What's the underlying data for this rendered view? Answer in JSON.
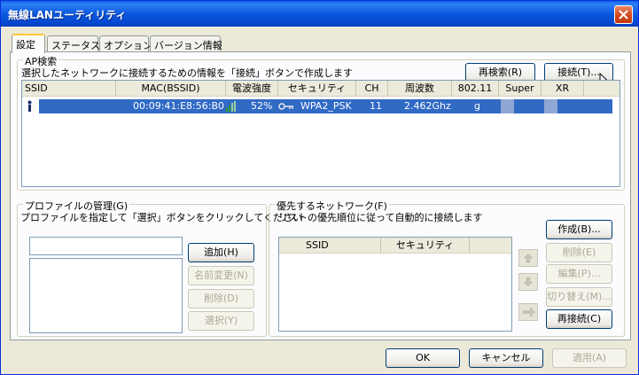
{
  "window": {
    "title": "無線LANユーティリティ"
  },
  "tabs": [
    "設定",
    "ステータス",
    "オプション",
    "バージョン情報"
  ],
  "ap_search": {
    "title": "AP検索",
    "description": "選択したネットワークに接続するための情報を「接続」ボタンで作成します",
    "rescan_label": "再検索(R)",
    "connect_label": "接続(T)...",
    "columns": [
      "SSID",
      "MAC(BSSID)",
      "電波強度",
      "セキュリティ",
      "CH",
      "周波数",
      "802.11",
      "Super",
      "XR"
    ],
    "rows": [
      {
        "ssid": "",
        "mac": "00:09:41:E8:56:B0",
        "signal": "52%",
        "security": "WPA2_PSK",
        "ch": "11",
        "freq": "2.462Ghz",
        "mode": "g",
        "super": "",
        "xr": ""
      }
    ]
  },
  "profile": {
    "title": "プロファイルの管理(G)",
    "description": "プロファイルを指定して「選択」ボタンをクリックしてください",
    "input_value": "",
    "add_label": "追加(H)",
    "rename_label": "名前変更(N)",
    "delete_label": "削除(D)",
    "select_label": "選択(Y)"
  },
  "preferred": {
    "title": "優先するネットワーク(F)",
    "description": "リストの優先順位に従って自動的に接続します",
    "columns": [
      "SSID",
      "セキュリティ"
    ],
    "create_label": "作成(B)...",
    "delete_label": "削除(E)",
    "edit_label": "編集(P)...",
    "switch_label": "切り替え(M)...",
    "reconnect_label": "再接続(C)"
  },
  "footer": {
    "ok_label": "OK",
    "cancel_label": "キャンセル",
    "apply_label": "適用(A)"
  },
  "colors": {
    "selection": "#316ac5",
    "titlebar": "#0a5fe8",
    "window_bg": "#ece9d8"
  }
}
